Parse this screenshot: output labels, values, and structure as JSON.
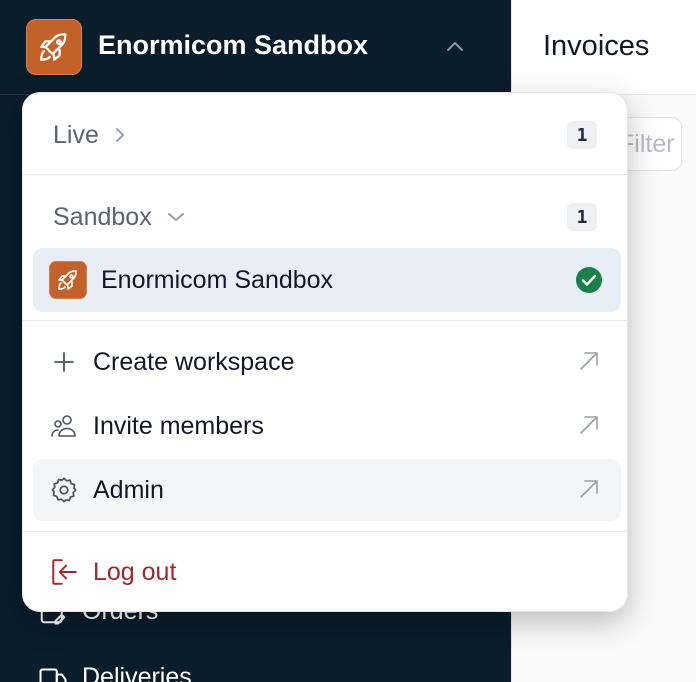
{
  "sidebar": {
    "workspace_name": "Enormicom Sandbox",
    "nav": [
      {
        "label": "Orders",
        "icon": "orders-icon"
      },
      {
        "label": "Deliveries",
        "icon": "deliveries-icon"
      }
    ]
  },
  "main": {
    "title": "Invoices",
    "filter_placeholder": "Filter"
  },
  "dropdown": {
    "live": {
      "label": "Live",
      "count": "1"
    },
    "sandbox": {
      "label": "Sandbox",
      "count": "1"
    },
    "current_workspace": {
      "name": "Enormicom Sandbox",
      "selected": true
    },
    "actions": [
      {
        "label": "Create workspace",
        "icon": "plus-icon"
      },
      {
        "label": "Invite members",
        "icon": "users-icon"
      },
      {
        "label": "Admin",
        "icon": "gear-icon"
      }
    ],
    "logout_label": "Log out"
  },
  "colors": {
    "sidebar_bg": "#0b1c2b",
    "brand_orange": "#c2622a",
    "selected_bg": "#e8eef5",
    "check_green": "#1a7f4b",
    "danger": "#a4262c"
  }
}
